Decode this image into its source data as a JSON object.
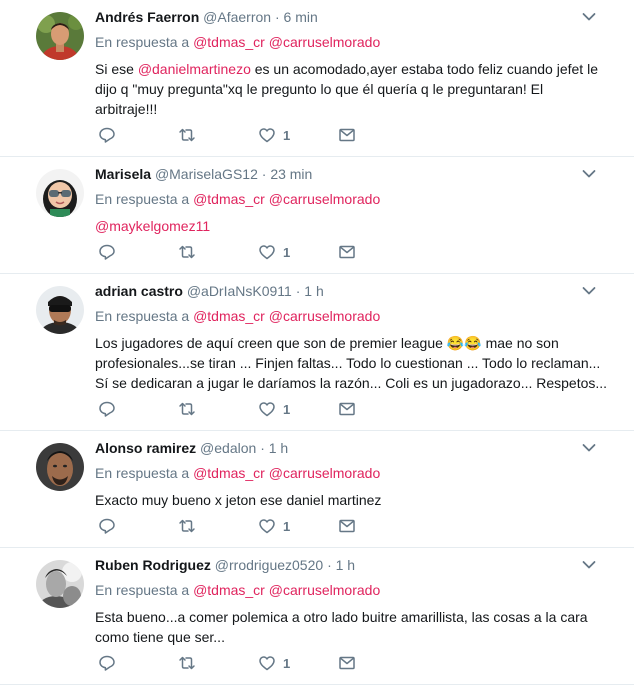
{
  "accent_color": "#e0245e",
  "reply_prefix": "En respuesta a",
  "tweets": [
    {
      "name": "Andrés Faerron",
      "handle": "@Afaerron",
      "dot": "·",
      "time": "6 min",
      "reply_to": [
        "@tdmas_cr",
        "@carruselmorado"
      ],
      "text_lines": [
        [
          {
            "m": "Si ese "
          },
          {
            "h": "@danielmartinezo"
          },
          {
            "m": " es un acomodado,ayer estaba todo feliz cuando jefet le"
          }
        ],
        [
          {
            "m": "dijo q \"muy pregunta\"xq le pregunto lo que él quería q le preguntaran! El"
          }
        ],
        [
          {
            "m": "arbitraje!!!"
          }
        ]
      ],
      "likes": "1",
      "avatar_icon": "avatar-photo"
    },
    {
      "name": "Marisela",
      "handle": "@MariselaGS12",
      "dot": "·",
      "time": "23 min",
      "reply_to": [
        "@tdmas_cr",
        "@carruselmorado"
      ],
      "text_lines": [
        [
          {
            "h": "@maykelgomez11"
          }
        ]
      ],
      "likes": "1",
      "avatar_icon": "avatar-photo"
    },
    {
      "name": "adrian castro",
      "handle": "@aDrIaNsK0911",
      "dot": "·",
      "time": "1 h",
      "reply_to": [
        "@tdmas_cr",
        "@carruselmorado"
      ],
      "text_lines": [
        [
          {
            "m": "Los jugadores de aquí creen que son de premier league "
          },
          {
            "e": "😂😂"
          },
          {
            "m": " mae no son"
          }
        ],
        [
          {
            "m": "profesionales...se tiran ... Finjen faltas... Todo lo cuestionan ... Todo lo reclaman..."
          }
        ],
        [
          {
            "m": "Sí se dedicaran a jugar le daríamos la razón... Coli es un jugadorazo... Respetos..."
          }
        ]
      ],
      "likes": "1",
      "avatar_icon": "avatar-photo"
    },
    {
      "name": "Alonso ramirez",
      "handle": "@edalon",
      "dot": "·",
      "time": "1 h",
      "reply_to": [
        "@tdmas_cr",
        "@carruselmorado"
      ],
      "text_lines": [
        [
          {
            "m": "Exacto muy bueno x jeton ese daniel martinez"
          }
        ]
      ],
      "likes": "1",
      "avatar_icon": "avatar-photo"
    },
    {
      "name": "Ruben Rodriguez",
      "handle": "@rrodriguez0520",
      "dot": "·",
      "time": "1 h",
      "reply_to": [
        "@tdmas_cr",
        "@carruselmorado"
      ],
      "text_lines": [
        [
          {
            "m": "Esta bueno...a comer polemica a otro lado buitre amarillista, las cosas a la cara"
          }
        ],
        [
          {
            "m": "como tiene que ser..."
          }
        ]
      ],
      "likes": "1",
      "avatar_icon": "avatar-photo"
    }
  ]
}
